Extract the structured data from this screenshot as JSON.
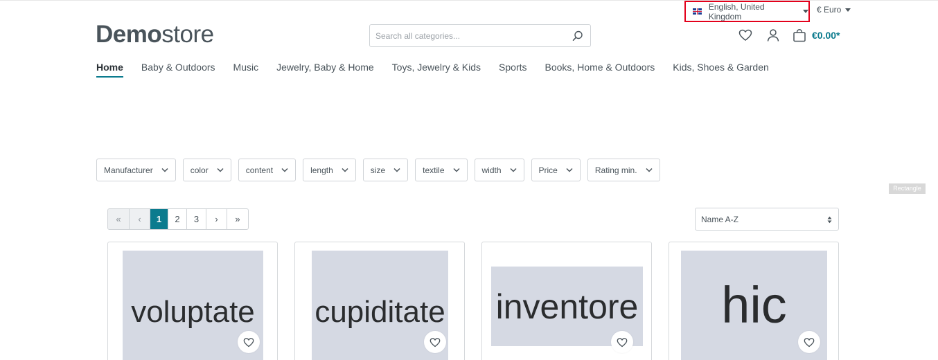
{
  "topbar": {
    "language": "English, United Kingdom",
    "currency": "€ Euro"
  },
  "header": {
    "logo_bold": "Demo",
    "logo_light": "store",
    "search_placeholder": "Search all categories...",
    "cart_total": "€0.00*"
  },
  "nav": {
    "items": [
      "Home",
      "Baby & Outdoors",
      "Music",
      "Jewelry, Baby & Home",
      "Toys, Jewelry & Kids",
      "Sports",
      "Books, Home & Outdoors",
      "Kids, Shoes & Garden"
    ]
  },
  "filters": [
    "Manufacturer",
    "color",
    "content",
    "length",
    "size",
    "textile",
    "width",
    "Price",
    "Rating min."
  ],
  "overlay_label": "Rectangle",
  "pagination": {
    "first": "«",
    "prev": "‹",
    "pages": [
      "1",
      "2",
      "3"
    ],
    "next": "›",
    "last": "»",
    "current": "1"
  },
  "sort": {
    "selected": "Name A-Z"
  },
  "products": [
    {
      "image_text": "voluptate"
    },
    {
      "image_text": "cupiditate"
    },
    {
      "image_text": "inventore"
    },
    {
      "image_text": "hic"
    }
  ],
  "colors": {
    "accent": "#0b7b8e",
    "highlight_border": "#e3001b",
    "thumb_bg": "#d5d9e3"
  }
}
